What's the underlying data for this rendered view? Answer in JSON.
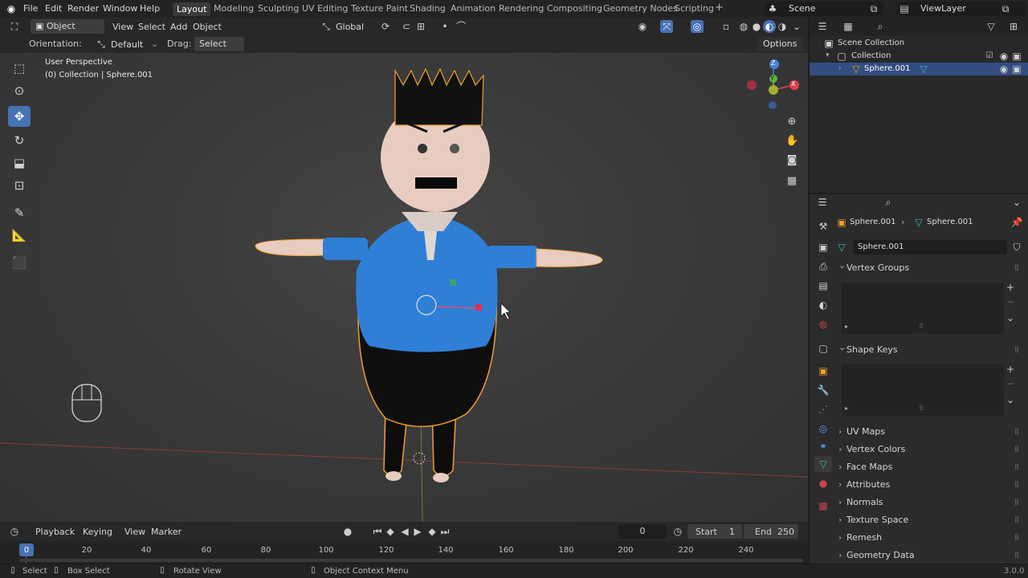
{
  "topbar": {
    "menus": [
      "File",
      "Edit",
      "Render",
      "Window",
      "Help"
    ],
    "workspaces": [
      "Layout",
      "Modeling",
      "Sculpting",
      "UV Editing",
      "Texture Paint",
      "Shading",
      "Animation",
      "Rendering",
      "Compositing",
      "Geometry Nodes",
      "Scripting"
    ],
    "active_workspace": "Layout",
    "add_tab": "+",
    "scene": "Scene",
    "view_layer": "ViewLayer"
  },
  "viewport_header": {
    "mode": "Object Mode",
    "menus": [
      "View",
      "Select",
      "Add",
      "Object"
    ],
    "transform_orientation": "Global"
  },
  "tool_header": {
    "orientation_label": "Orientation:",
    "orientation_value": "Default",
    "drag_label": "Drag:",
    "drag_value": "Select Box",
    "options": "Options"
  },
  "viewport": {
    "perspective": "User Perspective",
    "collection_info": "(0) Collection | Sphere.001",
    "gizmo": {
      "z": "Z",
      "y": "Y",
      "x": "X"
    }
  },
  "outliner": {
    "root": "Scene Collection",
    "collection": "Collection",
    "object": "Sphere.001"
  },
  "properties": {
    "breadcrumb_object": "Sphere.001",
    "breadcrumb_data": "Sphere.001",
    "mesh_name": "Sphere.001",
    "panels_open": [
      "Vertex Groups",
      "Shape Keys"
    ],
    "panels_closed": [
      "UV Maps",
      "Vertex Colors",
      "Face Maps",
      "Attributes",
      "Normals",
      "Texture Space",
      "Remesh",
      "Geometry Data"
    ]
  },
  "timeline": {
    "menus": [
      "Playback",
      "Keying",
      "View",
      "Marker"
    ],
    "current_frame": "0",
    "start_label": "Start",
    "start": "1",
    "end_label": "End",
    "end": "250",
    "ticks": [
      "0",
      "20",
      "40",
      "60",
      "80",
      "100",
      "120",
      "140",
      "160",
      "180",
      "200",
      "220",
      "240"
    ]
  },
  "status": {
    "select": "Select",
    "box_select": "Box Select",
    "rotate_view": "Rotate View",
    "context_menu": "Object Context Menu",
    "version": "3.0.0"
  },
  "colors": {
    "accent": "#4772b3",
    "selection_outline": "#f0a030",
    "shirt": "#2f7fd6",
    "skin": "#e8ccc0"
  }
}
